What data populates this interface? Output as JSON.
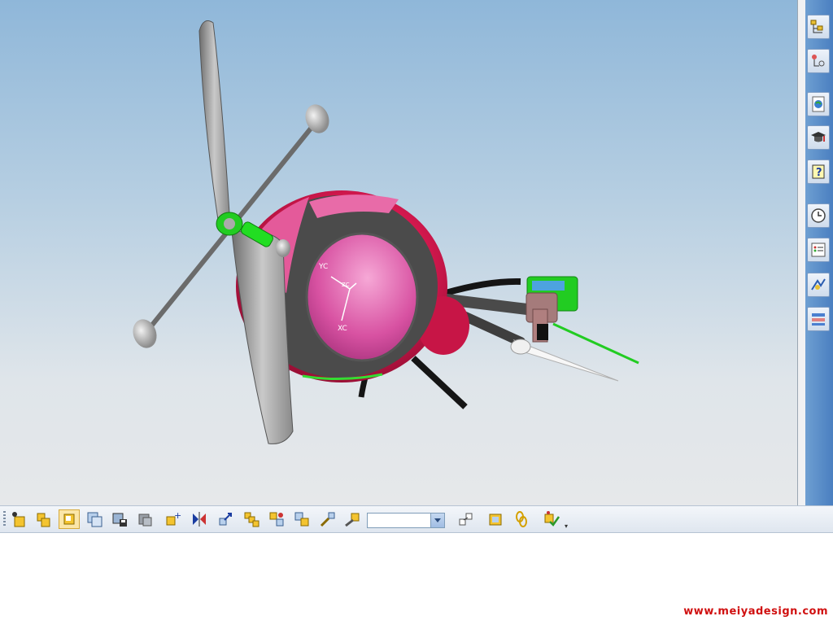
{
  "viewport": {
    "triad": {
      "xc_label": "XC",
      "yc_label": "YC",
      "zc_label": "ZC"
    },
    "model_description_icon": "helicopter-model"
  },
  "resource_bar": {
    "buttons": [
      {
        "name": "assembly-navigator-icon"
      },
      {
        "name": "part-navigator-icon"
      },
      {
        "name": "web-browser-icon"
      },
      {
        "name": "training-icon"
      },
      {
        "name": "help-icon"
      },
      {
        "name": "history-icon"
      },
      {
        "name": "system-materials-icon"
      },
      {
        "name": "process-studio-icon"
      },
      {
        "name": "roles-icon"
      }
    ]
  },
  "toolbar": {
    "select_value": "",
    "buttons": [
      "add-component-icon",
      "new-component-icon",
      "reference-set-icon",
      "replace-component-icon",
      "save-assembly-icon",
      "hide-component-icon",
      "add-constraint-icon",
      "mirror-assembly-icon",
      "move-component-icon",
      "component-array-icon",
      "create-array-icon",
      "assembly-sequence-icon",
      "explode-icon",
      "clearance-icon",
      "wave-link-icon",
      "interpart-link-icon",
      "check-constraints-icon"
    ]
  },
  "watermark": "www.meiyadesign.com"
}
